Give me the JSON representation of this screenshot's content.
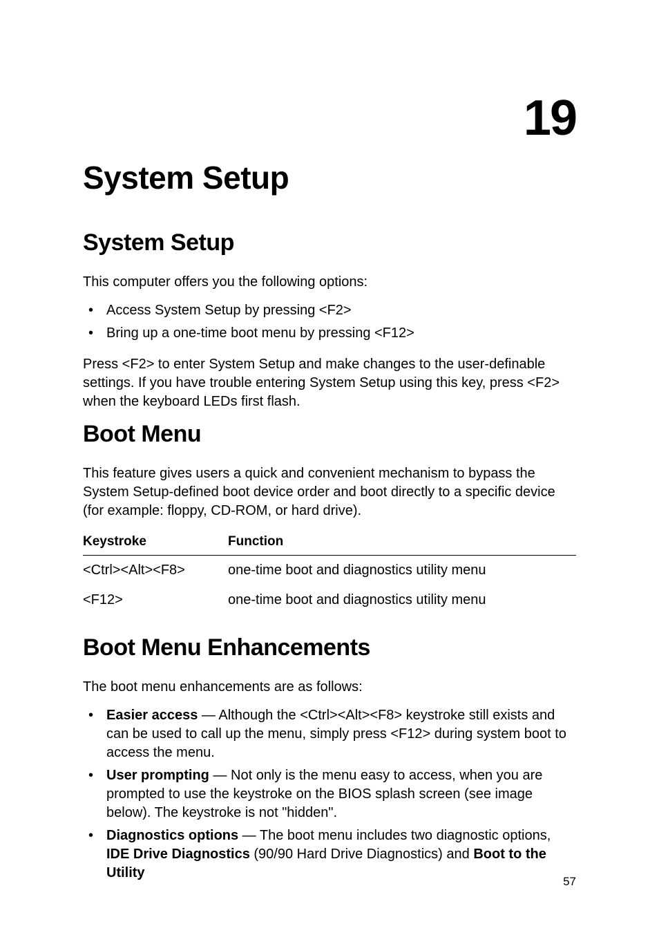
{
  "chapter_number": "19",
  "title_h1": "System Setup",
  "section1": {
    "heading": "System Setup",
    "intro": "This computer offers you the following options:",
    "bullets": [
      "Access System Setup by pressing <F2>",
      "Bring up a one-time boot menu by pressing <F12>"
    ],
    "after": "Press <F2> to enter System Setup and make changes to the user-definable settings. If you have trouble entering System Setup using this key, press <F2> when the keyboard LEDs first flash."
  },
  "section2": {
    "heading": "Boot Menu",
    "intro": "This feature gives users a quick and convenient mechanism to bypass the System Setup-defined boot device order and boot directly to a specific device (for example: floppy, CD-ROM, or hard drive).",
    "table": {
      "headers": {
        "key": "Keystroke",
        "fn": "Function"
      },
      "rows": [
        {
          "key": "<Ctrl><Alt><F8>",
          "fn": "one-time boot and diagnostics utility menu"
        },
        {
          "key": "<F12>",
          "fn": "one-time boot and diagnostics utility menu"
        }
      ]
    }
  },
  "section3": {
    "heading": "Boot Menu Enhancements",
    "intro": "The boot menu enhancements are as follows:",
    "items": [
      {
        "lead": "Easier access",
        "rest": " — Although the <Ctrl><Alt><F8> keystroke still exists and can be used to call up the menu, simply press <F12> during system boot to access the menu."
      },
      {
        "lead": "User prompting",
        "rest": " — Not only is the menu easy to access, when you are prompted to use the keystroke on the BIOS splash screen (see image below). The keystroke is not \"hidden\"."
      },
      {
        "lead": "Diagnostics options",
        "rest_prefix": " — The boot menu includes two diagnostic options, ",
        "bold2": "IDE Drive Diagnostics",
        "mid": " (90/90 Hard Drive Diagnostics) and ",
        "bold3": "Boot to the Utility"
      }
    ]
  },
  "page_number": "57"
}
